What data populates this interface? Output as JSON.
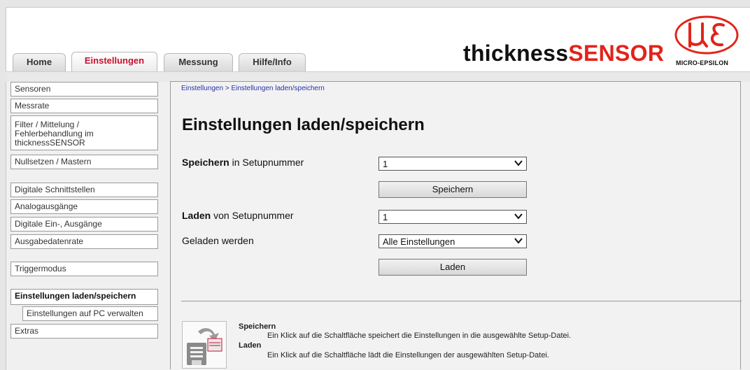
{
  "tabs": [
    {
      "label": "Home",
      "active": false
    },
    {
      "label": "Einstellungen",
      "active": true
    },
    {
      "label": "Messung",
      "active": false
    },
    {
      "label": "Hilfe/Info",
      "active": false
    }
  ],
  "brand": {
    "part1": "thickness",
    "part2": "SENSOR",
    "logo_text": "MICRO-EPSILON"
  },
  "sidebar": {
    "items": [
      "Sensoren",
      "Messrate",
      "Filter / Mittelung /",
      "Fehlerbehandlung im",
      "thicknessSENSOR",
      "Nullsetzen / Mastern",
      "Digitale Schnittstellen",
      "Analogausgänge",
      "Digitale Ein-, Ausgänge",
      "Ausgabedatenrate",
      "Triggermodus",
      "Einstellungen laden/speichern",
      "Einstellungen auf PC verwalten",
      "Extras"
    ]
  },
  "main": {
    "breadcrumb": "Einstellungen > Einstellungen laden/speichern",
    "title": "Einstellungen laden/speichern",
    "save_label_bold": "Speichern",
    "save_label_rest": " in Setupnummer",
    "save_value": "1",
    "save_button": "Speichern",
    "load_label_bold": "Laden",
    "load_label_rest": " von Setupnummer",
    "load_value": "1",
    "loaded_label": "Geladen werden",
    "loaded_value": "Alle Einstellungen",
    "load_button": "Laden"
  },
  "help": {
    "save_title": "Speichern",
    "save_text": "Ein Klick auf die Schaltfläche speichert die Einstellungen in die ausgewählte Setup-Datei.",
    "load_title": "Laden",
    "load_text": "Ein Klick auf die Schaltfläche lädt die Einstellungen der ausgewählten Setup-Datei."
  },
  "colors": {
    "accent_red": "#e2231a",
    "link_blue": "#2433a8"
  }
}
